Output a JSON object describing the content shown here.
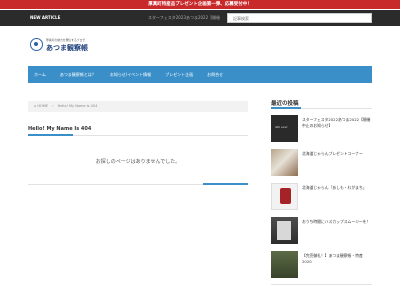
{
  "top_banner": {
    "text": "厚真町特産品プレゼント企画第一弾、応募受付中！"
  },
  "news_bar": {
    "label": "NEW ARTICLE",
    "ticker": "スターフェスタ2023あつま2022【開催",
    "search_placeholder": "記事検索"
  },
  "logo": {
    "subtitle": "厚真町の魅力を発信するブログ",
    "title": "あつま観察帳"
  },
  "nav": {
    "items": [
      "ホーム",
      "あつま観察帳とは？",
      "お知らせ/イベント情報",
      "プレゼント企画",
      "お問合せ"
    ]
  },
  "breadcrumb": {
    "home": "HOME",
    "current": "Hello! My Name Is 404"
  },
  "main": {
    "title": "Hello! My Name Is 404",
    "message": "お探しのページはありませんでした。"
  },
  "sidebar": {
    "heading": "最近の投稿",
    "posts": [
      {
        "title": "スターフェスタ2022あつま2022【開催中止のお知らせ】"
      },
      {
        "title": "北海道じゃらんプレゼントコーナー"
      },
      {
        "title": "北海道じゃらん「あしも・わがまち」"
      },
      {
        "title": "おうち時間にハスカップスムージーを！"
      },
      {
        "title": "【完売御礼！】あつま観察帳・特産2020"
      }
    ]
  }
}
